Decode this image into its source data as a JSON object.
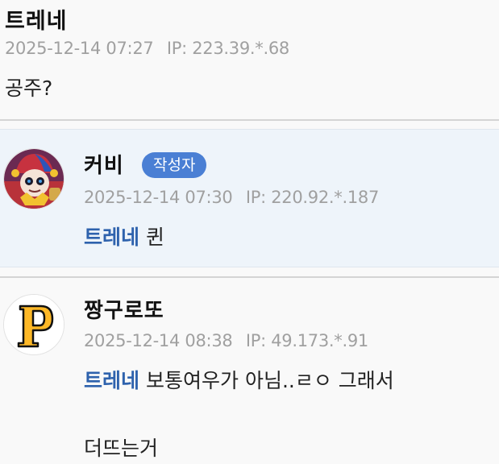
{
  "comments": [
    {
      "nickname": "트레네",
      "timestamp": "2025-12-14 07:27",
      "ip": "IP: 223.39.*.68",
      "text": "공주?"
    },
    {
      "nickname": "커비",
      "badge": "작성자",
      "timestamp": "2025-12-14 07:30",
      "ip": "IP: 220.92.*.187",
      "mention": "트레네",
      "text": "퀸"
    },
    {
      "nickname": "짱구로또",
      "timestamp": "2025-12-14 08:38",
      "ip": "IP: 49.173.*.91",
      "mention": "트레네",
      "text_line1": "보통여우가 아님..ㄹㅇ 그래서",
      "text_line2": "더뜨는거"
    }
  ],
  "colors": {
    "author_highlight_bg": "#eef4fa",
    "badge_bg": "#4a7fd4",
    "mention": "#2e62ad",
    "meta_text": "#a0a0a0"
  },
  "icons": {
    "avatar_1": "pomni-character-avatar",
    "avatar_2": "pirates-p-logo-avatar"
  }
}
